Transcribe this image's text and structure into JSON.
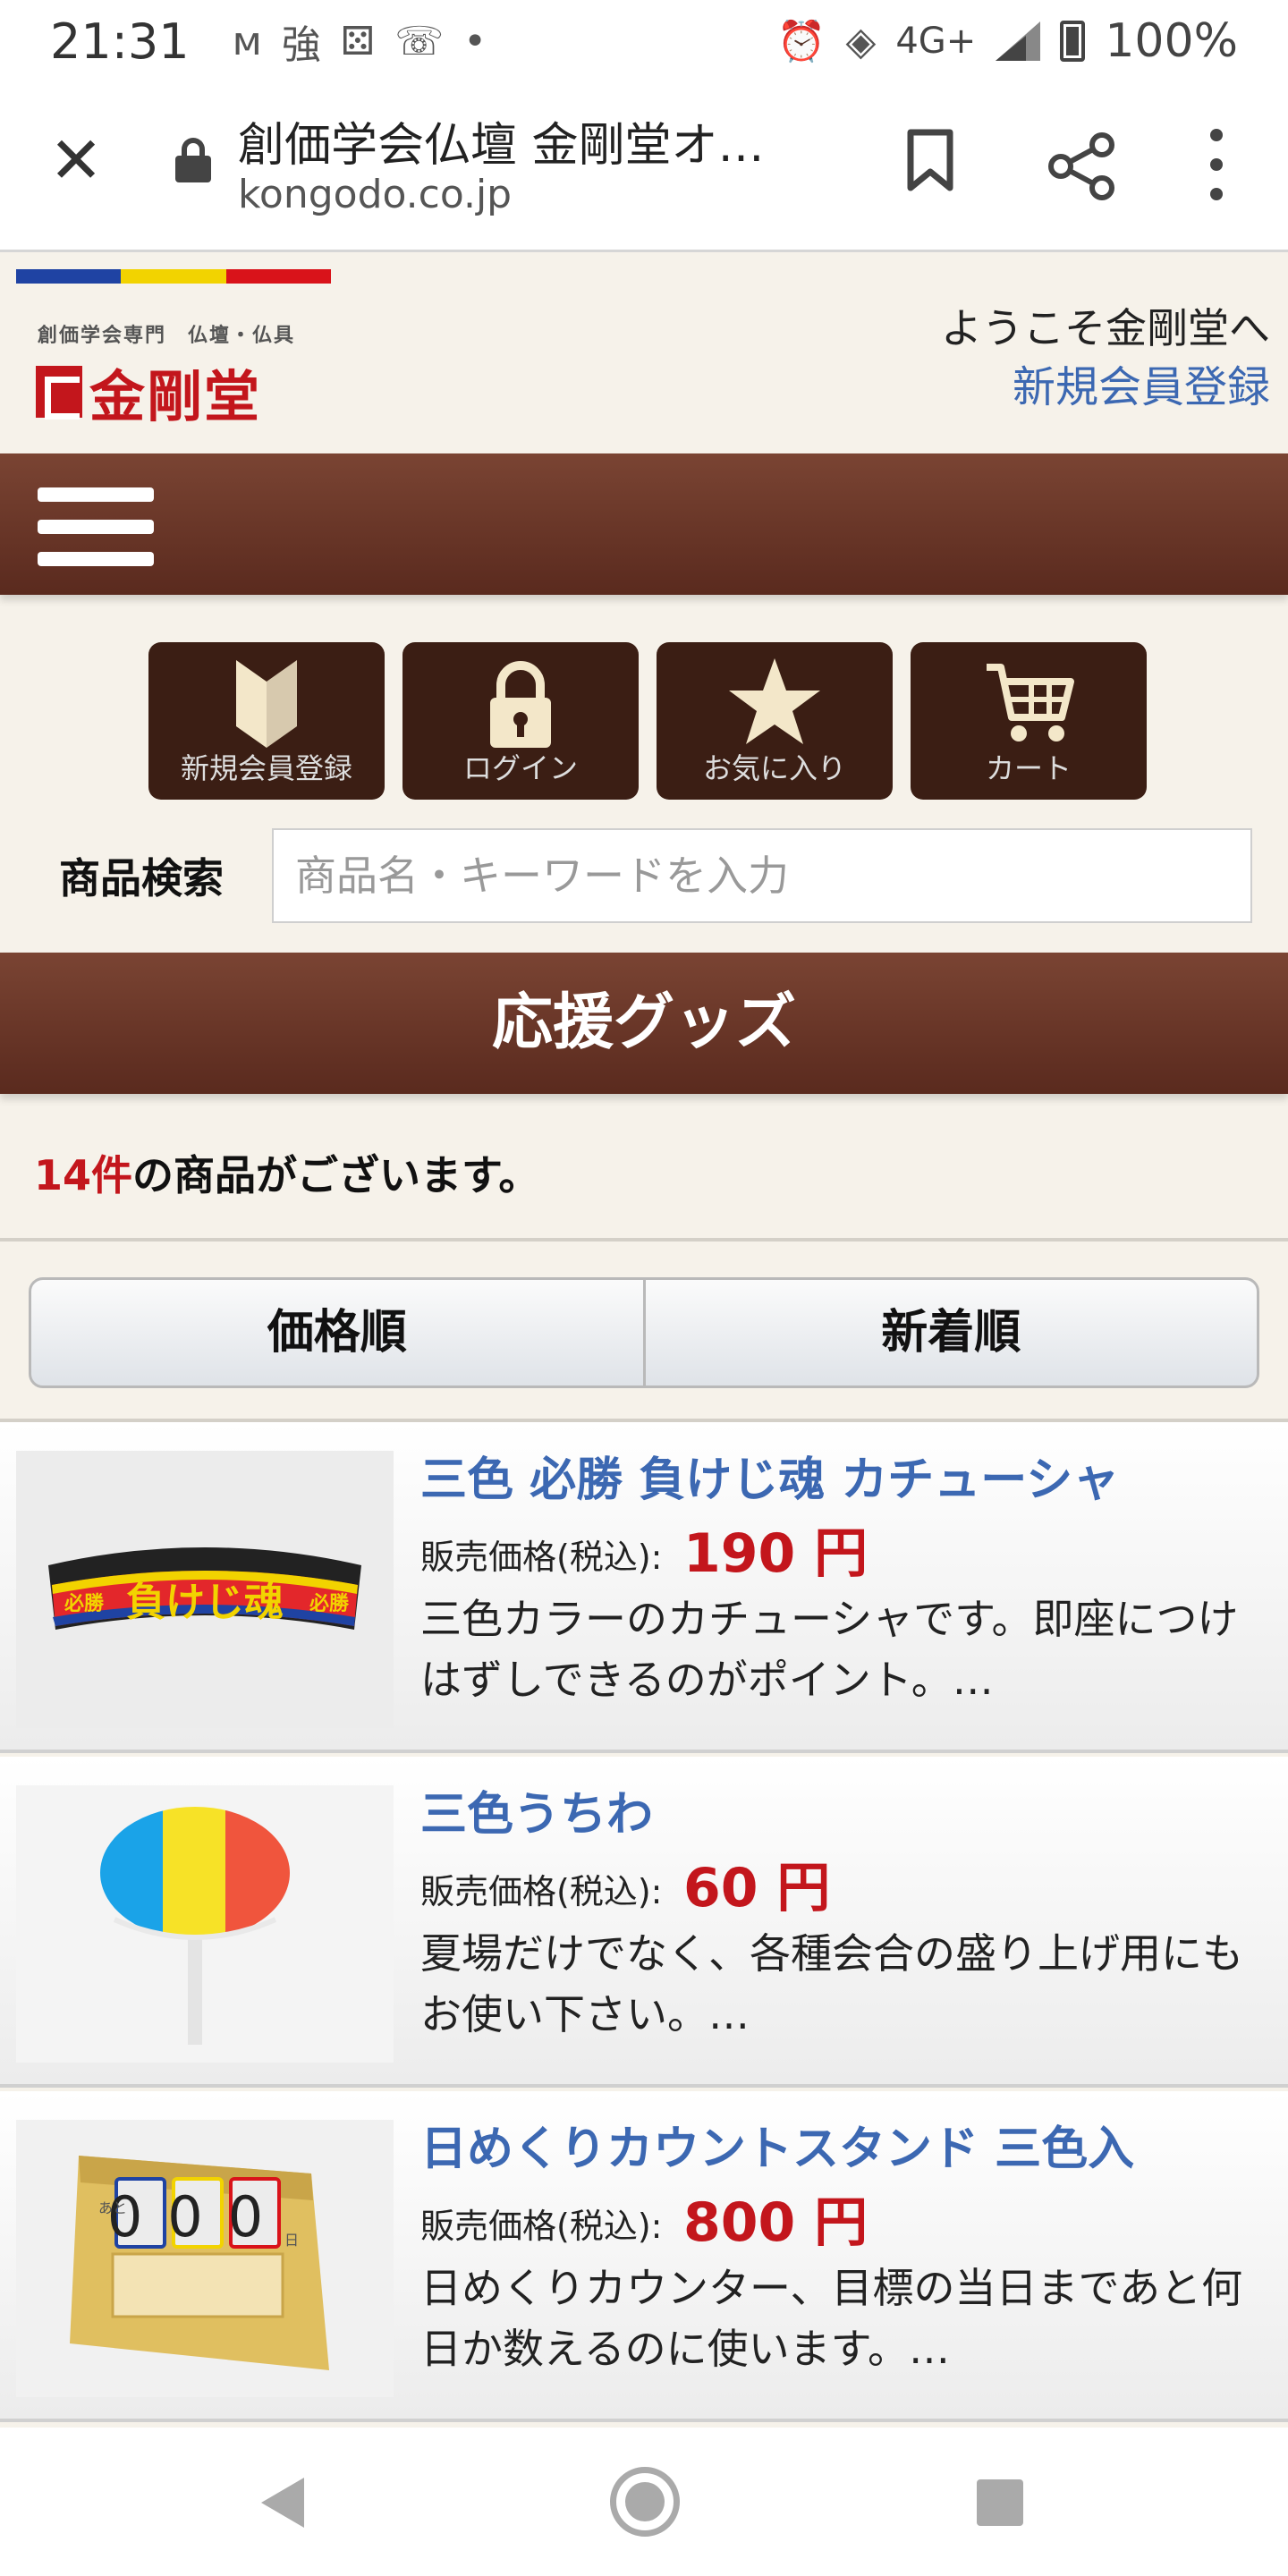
{
  "status_bar": {
    "time": "21:31",
    "signal_text": "強",
    "network": "4G+",
    "battery": "100%"
  },
  "browser": {
    "page_title": "創価学会仏壇 金剛堂オ…",
    "url": "kongodo.co.jp",
    "icons": [
      "close-icon",
      "lock-icon",
      "bookmark-icon",
      "share-icon",
      "more-icon"
    ]
  },
  "site": {
    "logo_sub": "創価学会専門　仏壇・仏具",
    "logo_name": "金剛堂",
    "welcome": "ようこそ金剛堂へ",
    "signup_link": "新規会員登録",
    "stripe_colors": [
      "#1f43a3",
      "#f2d300",
      "#d9131a"
    ]
  },
  "quick_buttons": [
    {
      "label": "新規会員登録",
      "icon": "beginner-mark-icon"
    },
    {
      "label": "ログイン",
      "icon": "lock-icon"
    },
    {
      "label": "お気に入り",
      "icon": "star-icon"
    },
    {
      "label": "カート",
      "icon": "cart-icon"
    }
  ],
  "search": {
    "label": "商品検索",
    "placeholder": "商品名・キーワードを入力",
    "value": ""
  },
  "category_title": "応援グッズ",
  "result": {
    "count": "14件",
    "suffix": "の商品がございます。"
  },
  "sort": {
    "price": "価格順",
    "newest": "新着順"
  },
  "products": [
    {
      "name": "三色 必勝 負けじ魂 カチューシャ",
      "price_label": "販売価格(税込):",
      "price": "190 円",
      "desc": "三色カラーのカチューシャです。即座につけはずしできるのがポイント。…",
      "thumb_text": "負けじ魂",
      "thumb_side": "必勝"
    },
    {
      "name": "三色うちわ",
      "price_label": "販売価格(税込):",
      "price": "60 円",
      "desc": "夏場だけでなく、各種会合の盛り上げ用にもお使い下さい。…"
    },
    {
      "name": "日めくりカウントスタンド 三色入",
      "price_label": "販売価格(税込):",
      "price": "800 円",
      "desc": "日めくりカウンター、目標の当日まであと何日か数えるのに使います。…",
      "thumb_digits": "000",
      "thumb_prefix": "あと",
      "thumb_suffix": "日"
    }
  ],
  "accent_colors": {
    "brown": "#5a2a1e",
    "link_blue": "#3c68b2",
    "price_red": "#c3161c"
  }
}
